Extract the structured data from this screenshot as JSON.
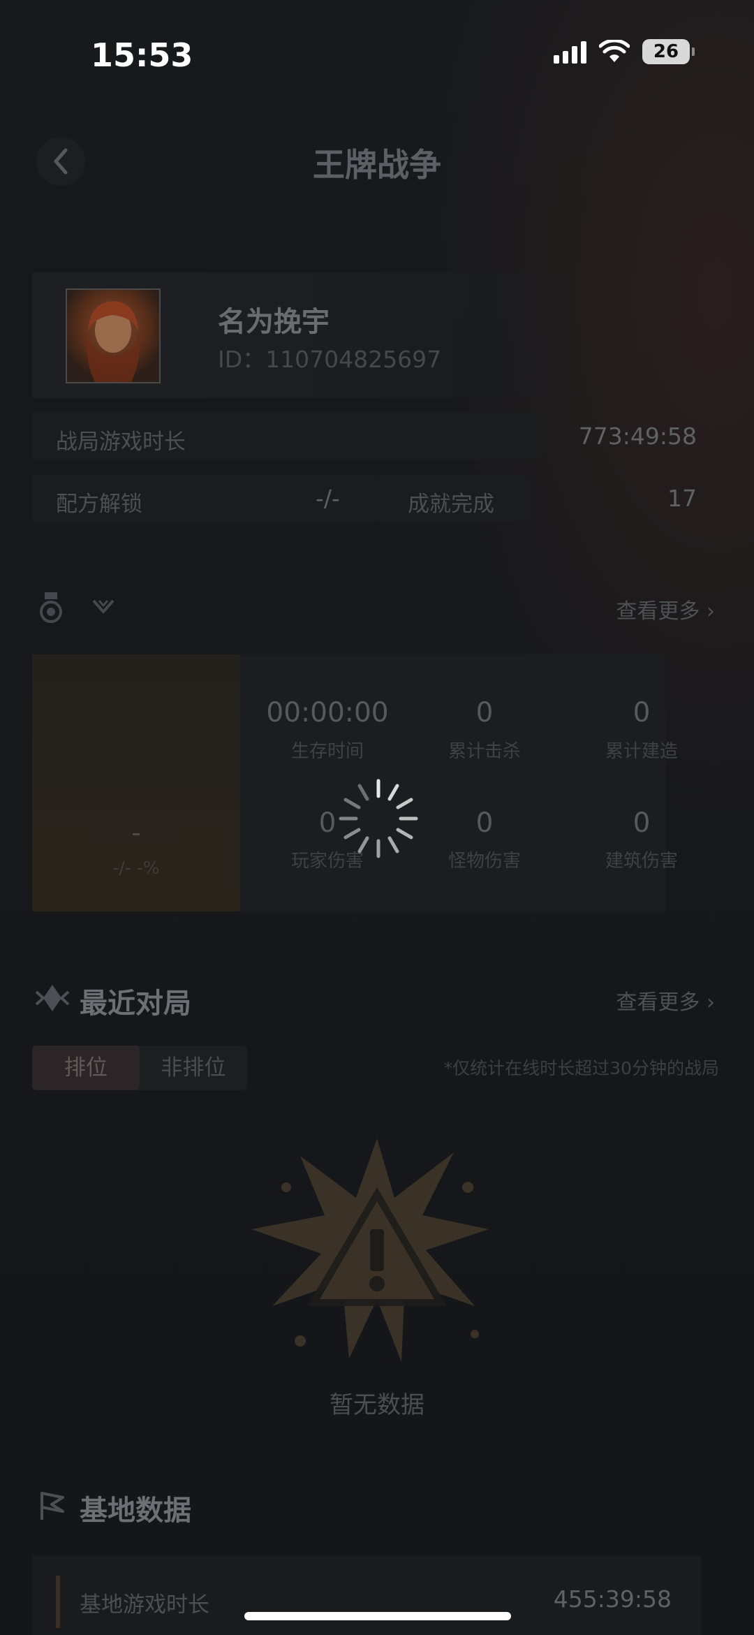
{
  "status": {
    "time": "15:53",
    "battery": "26"
  },
  "nav": {
    "title": "王牌战争"
  },
  "profile": {
    "name": "名为挽宇",
    "id": "ID：110704825697"
  },
  "stats": {
    "playtime_label": "战局游戏时长",
    "playtime_value": "773:49:58",
    "recipe_label": "配方解锁",
    "recipe_value": "-/-",
    "achieve_label": "成就完成",
    "achieve_value": "17"
  },
  "season": {
    "more": "查看更多",
    "rank_value": "-",
    "rank_pct": "-/- -%",
    "items": [
      {
        "value": "00:00:00",
        "label": "生存时间"
      },
      {
        "value": "0",
        "label": "累计击杀"
      },
      {
        "value": "0",
        "label": "累计建造"
      },
      {
        "value": "0",
        "label": "玩家伤害"
      },
      {
        "value": "0",
        "label": "怪物伤害"
      },
      {
        "value": "0",
        "label": "建筑伤害"
      }
    ]
  },
  "recent": {
    "title": "最近对局",
    "more": "查看更多",
    "tab_ranked": "排位",
    "tab_unranked": "非排位",
    "note": "*仅统计在线时长超过30分钟的战局",
    "empty": "暂无数据"
  },
  "base": {
    "title": "基地数据",
    "playtime_label": "基地游戏时长",
    "playtime_value": "455:39:58"
  }
}
